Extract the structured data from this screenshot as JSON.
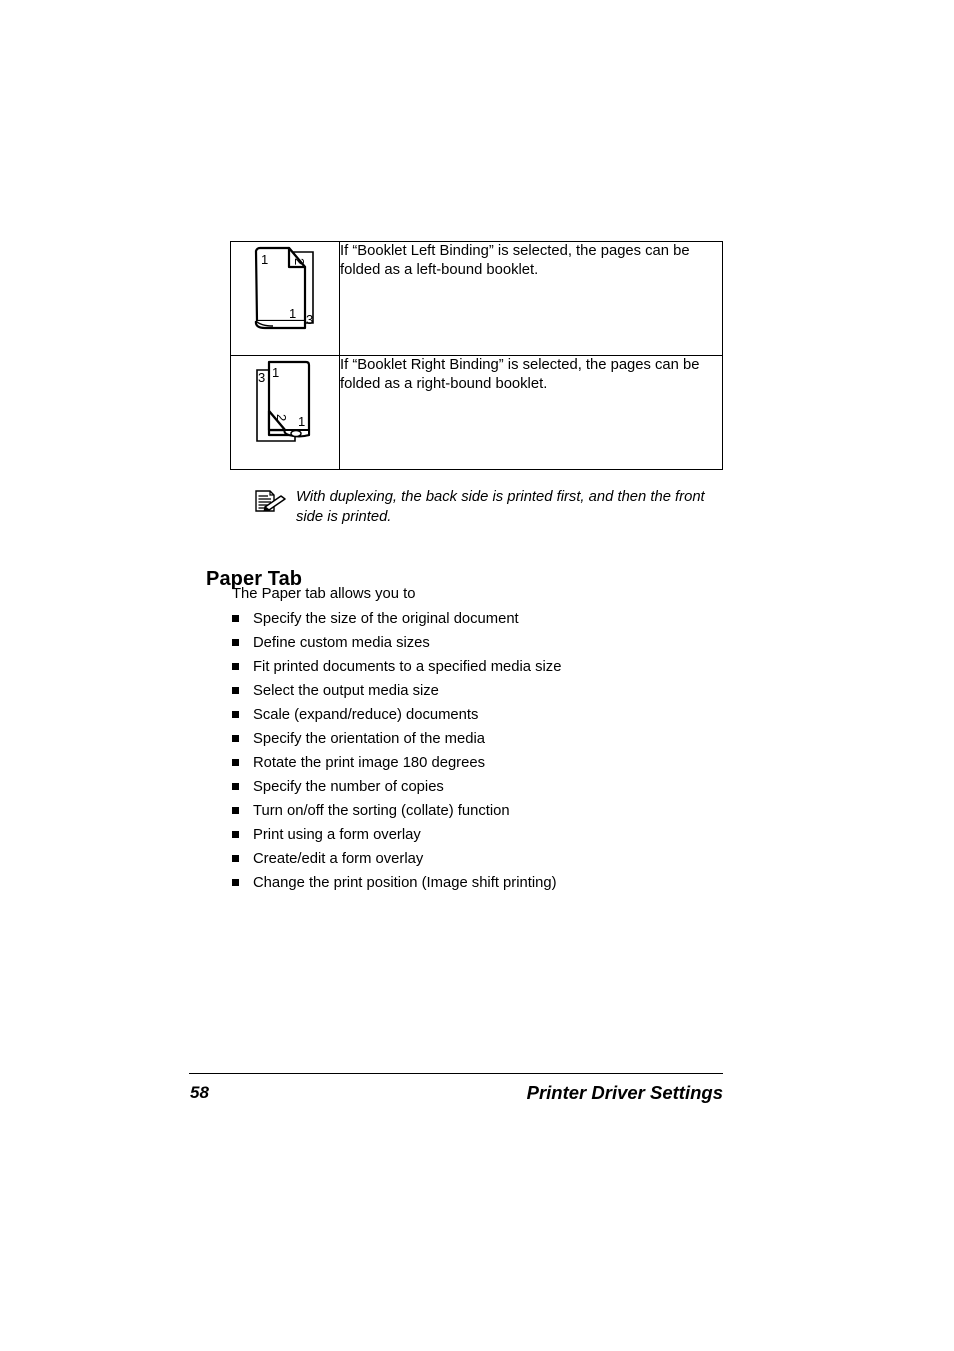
{
  "document": {
    "page_number": "58",
    "footer_title": "Printer Driver Settings"
  },
  "table": {
    "rows": [
      {
        "illustration": "booklet-left-binding-illustration",
        "illustration_labels": [
          "1",
          "2",
          "1",
          "3"
        ],
        "text": "If “Booklet Left Binding” is selected, the pages can be folded as a left-bound booklet."
      },
      {
        "illustration": "booklet-right-binding-illustration",
        "illustration_labels": [
          "3",
          "1",
          "2",
          "1"
        ],
        "text": "If “Booklet Right Binding” is selected, the pages can be folded as a right-bound booklet."
      }
    ]
  },
  "note": {
    "icon": "note-pencil-icon",
    "text": "With duplexing, the back side is printed first, and then the front side is printed."
  },
  "section": {
    "heading": "Paper Tab",
    "intro": "The Paper tab allows you to",
    "bullets": [
      "Specify the size of the original document",
      "Define custom media sizes",
      "Fit printed documents to a specified media size",
      "Select the output media size",
      "Scale (expand/reduce) documents",
      "Specify the orientation of the media",
      "Rotate the print image 180 degrees",
      "Specify the number of copies",
      "Turn on/off the sorting (collate) function",
      "Print using a form overlay",
      "Create/edit a form overlay",
      "Change the print position (Image shift printing)"
    ]
  },
  "colors": {
    "text": "#000000",
    "background": "#ffffff",
    "rule": "#000000"
  }
}
